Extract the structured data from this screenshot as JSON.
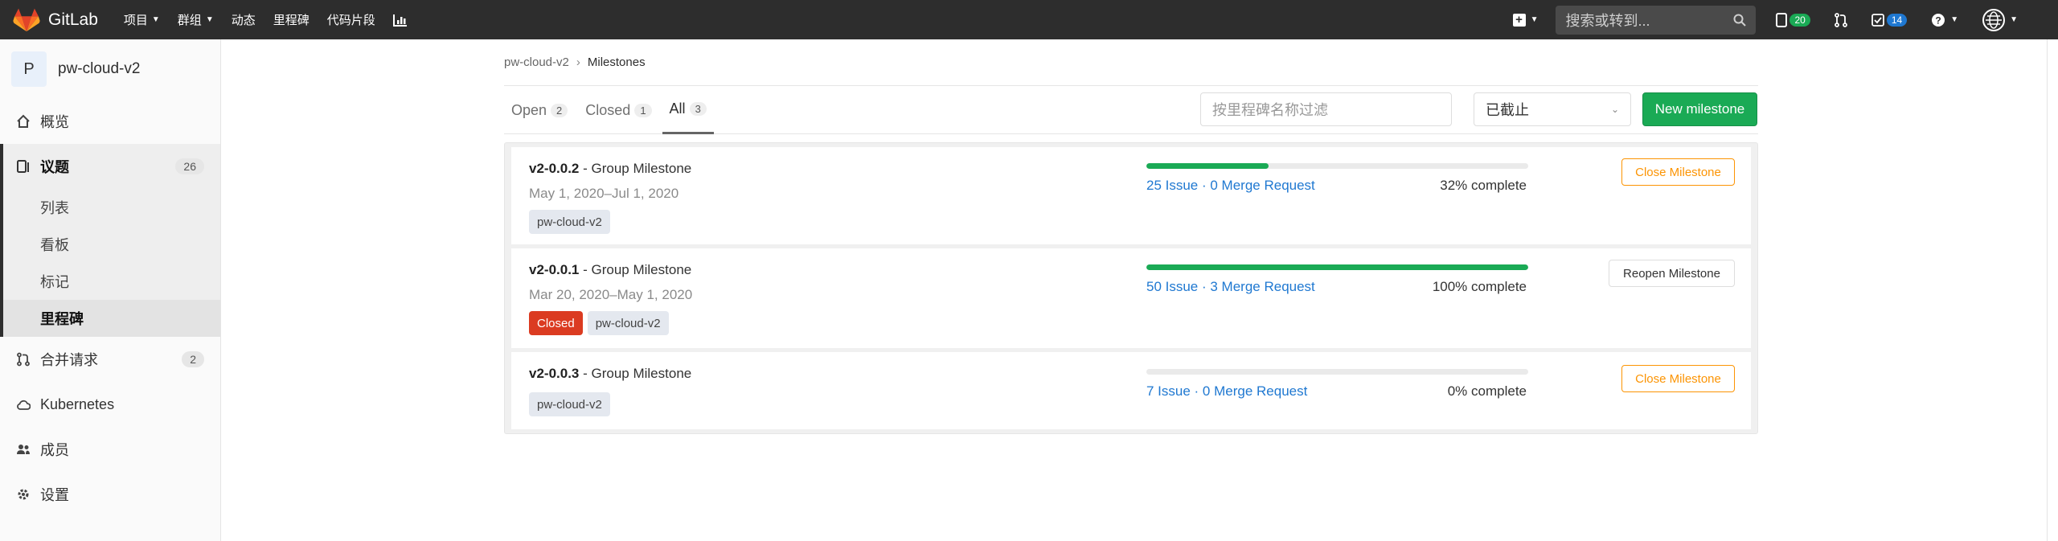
{
  "navbar": {
    "brand": "GitLab",
    "menu": [
      {
        "label": "项目",
        "dropdown": true
      },
      {
        "label": "群组",
        "dropdown": true
      },
      {
        "label": "动态",
        "dropdown": false
      },
      {
        "label": "里程碑",
        "dropdown": false
      },
      {
        "label": "代码片段",
        "dropdown": false
      }
    ],
    "search_placeholder": "搜索或转到...",
    "issues_count": "20",
    "todos_count": "14"
  },
  "sidebar": {
    "project_avatar": "P",
    "project_name": "pw-cloud-v2",
    "items": [
      {
        "label": "概览"
      },
      {
        "label": "议题",
        "count": "26"
      },
      {
        "label": "合并请求",
        "count": "2"
      },
      {
        "label": "Kubernetes"
      },
      {
        "label": "成员"
      },
      {
        "label": "设置"
      }
    ],
    "issues_sub": [
      "列表",
      "看板",
      "标记",
      "里程碑"
    ]
  },
  "breadcrumb": {
    "parent": "pw-cloud-v2",
    "current": "Milestones"
  },
  "tabs": [
    {
      "label": "Open",
      "count": "2"
    },
    {
      "label": "Closed",
      "count": "1"
    },
    {
      "label": "All",
      "count": "3"
    }
  ],
  "filter": {
    "placeholder": "按里程碑名称过滤",
    "state_value": "已截止"
  },
  "new_milestone_label": "New milestone",
  "milestones": [
    {
      "name": "v2-0.0.2",
      "type": " - Group Milestone",
      "dates": "May 1, 2020–Jul 1, 2020",
      "project": "pw-cloud-v2",
      "counts": "25 Issue · 0 Merge Request",
      "progress": 32,
      "complete": "32% complete",
      "action": "Close Milestone"
    },
    {
      "name": "v2-0.0.1",
      "type": " - Group Milestone",
      "dates": "Mar 20, 2020–May 1, 2020",
      "status": "Closed",
      "project": "pw-cloud-v2",
      "counts": "50 Issue · 3 Merge Request",
      "progress": 100,
      "complete": "100% complete",
      "action": "Reopen Milestone"
    },
    {
      "name": "v2-0.0.3",
      "type": " - Group Milestone",
      "project": "pw-cloud-v2",
      "counts": "7 Issue · 0 Merge Request",
      "progress": 0,
      "complete": "0% complete",
      "action": "Close Milestone"
    }
  ],
  "colors": {
    "navbar": "#2d2d2d",
    "success": "#1aaa55",
    "warning": "#fc9403",
    "danger": "#db3b21",
    "link": "#1f78d1"
  }
}
